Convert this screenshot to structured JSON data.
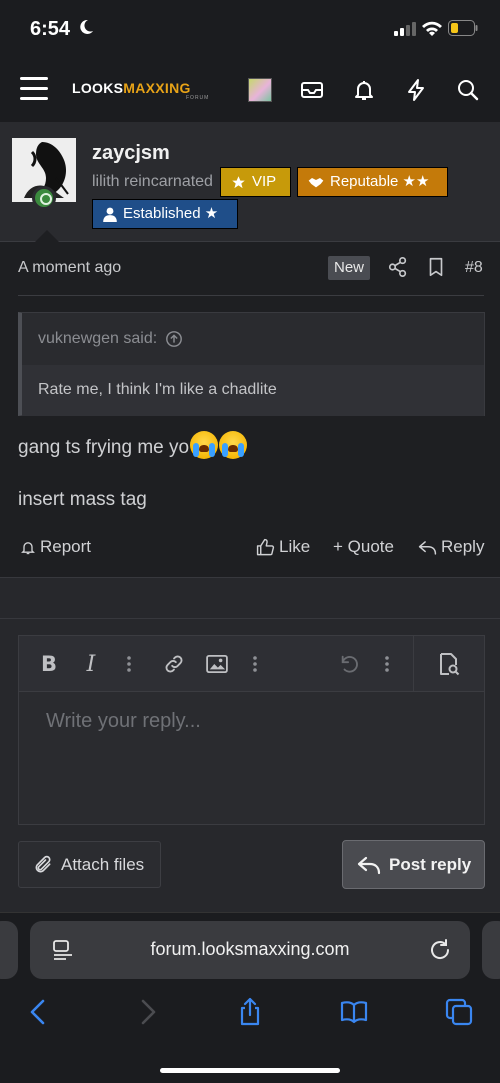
{
  "status_bar": {
    "time": "6:54"
  },
  "nav": {
    "brand_main": "LOOKS",
    "brand_accent": "MAXXING",
    "brand_sub": "FORUM",
    "icons": [
      "menu-icon",
      "avatar",
      "mail-icon",
      "bell-icon",
      "bolt-icon",
      "search-icon"
    ]
  },
  "post": {
    "author": {
      "username": "zaycjsm",
      "title": "lilith reincarnated",
      "badges": [
        "VIP",
        "Reputable ★★",
        "Established ★"
      ]
    },
    "time": "A moment ago",
    "new_label": "New",
    "number": "#8",
    "quote": {
      "author": "vuknewgen said:",
      "text": "Rate me, I think I'm like a chadlite"
    },
    "body_line1": "gang ts frying me yo",
    "body_line2": "insert mass tag",
    "actions": {
      "report": "Report",
      "like": "Like",
      "quote": "+ Quote",
      "reply": "Reply"
    }
  },
  "editor": {
    "placeholder": "Write your reply...",
    "attach_label": "Attach files",
    "post_reply_label": "Post reply"
  },
  "browser": {
    "url": "forum.looksmaxxing.com"
  },
  "colors": {
    "vip": "#c79a0a",
    "reputable": "#c47a0a",
    "established": "#1f4e89",
    "brand_accent": "#e8a317",
    "browser_accent": "#3a86f0"
  }
}
